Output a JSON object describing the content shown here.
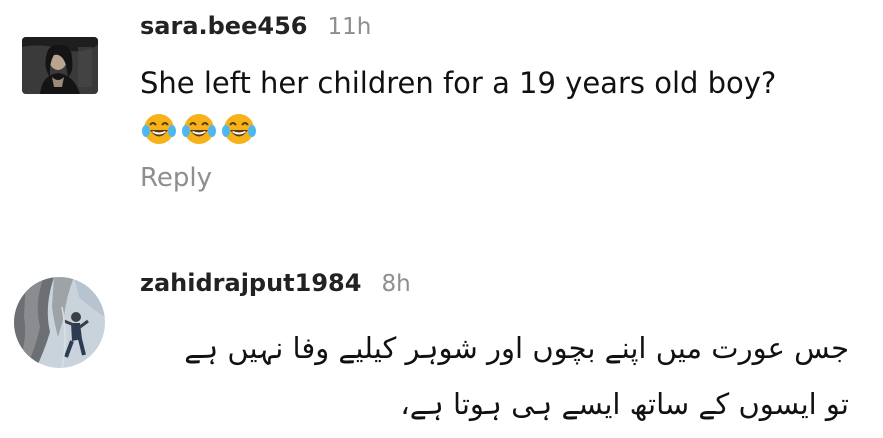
{
  "comments": [
    {
      "username": "sara.bee456",
      "timestamp": "11h",
      "text": "She left her children for a 19 years old boy?",
      "emojis": [
        "😂",
        "😂",
        "😂"
      ],
      "reply_label": "Reply"
    },
    {
      "username": "zahidrajput1984",
      "timestamp": "8h",
      "text_lines": [
        "جس عورت میں اپنے بچوں اور شوہر کیلیے وفا نہیں ہے",
        "تو ایسوں کے ساتھ ایسے ہی ہوتا ہے،"
      ]
    }
  ],
  "icons": {
    "emoji": "face-with-tears-of-joy-icon"
  },
  "colors": {
    "username": "#222222",
    "muted": "#8e8e8e",
    "text": "#111111",
    "emoji_face": "#f7b21a"
  }
}
